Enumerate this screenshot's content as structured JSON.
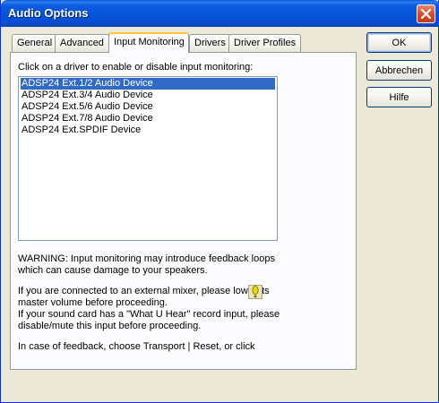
{
  "window": {
    "title": "Audio Options"
  },
  "tabs": [
    {
      "label": "General"
    },
    {
      "label": "Advanced"
    },
    {
      "label": "Input Monitoring"
    },
    {
      "label": "Drivers"
    },
    {
      "label": "Driver Profiles"
    }
  ],
  "active_tab": "Input Monitoring",
  "panel": {
    "instruction": "Click on a driver to enable or disable input monitoring:",
    "drivers": [
      {
        "label": "ADSP24 Ext.1/2 Audio Device",
        "selected": true
      },
      {
        "label": "ADSP24 Ext.3/4 Audio Device",
        "selected": false
      },
      {
        "label": "ADSP24 Ext.5/6 Audio Device",
        "selected": false
      },
      {
        "label": "ADSP24 Ext.7/8 Audio Device",
        "selected": false
      },
      {
        "label": "ADSP24 Ext.SPDIF Device",
        "selected": false
      }
    ],
    "warning_line1": "WARNING: Input monitoring may introduce feedback loops",
    "warning_line2": "which can cause damage to your speakers.",
    "mixer_line1": "If you are connected to an external mixer, please lower its",
    "mixer_line2": "master volume before proceeding.",
    "whatuhear_line1": "If your sound card has a \"What U Hear\" record input, please",
    "whatuhear_line2": "disable/mute this input before proceeding.",
    "feedback_line": "In case of feedback, choose Transport | Reset, or click"
  },
  "buttons": {
    "ok": "OK",
    "cancel": "Abbrechen",
    "help": "Hilfe"
  },
  "colors": {
    "selection": "#316AC5",
    "tab_highlight": "#FFC83C",
    "titlebar": "#0554D8"
  }
}
